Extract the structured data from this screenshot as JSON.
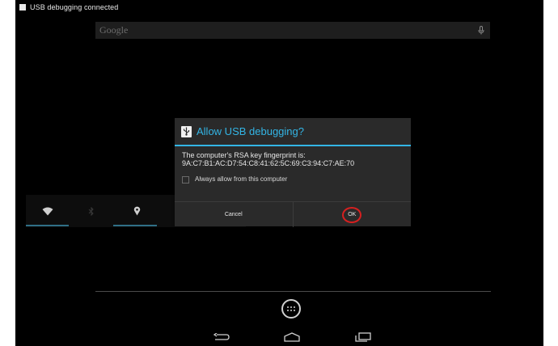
{
  "status_bar": {
    "notification_text": "USB debugging connected",
    "notification_icon": "usb-debug-notification-icon"
  },
  "search": {
    "brand": "Google",
    "mic_icon": "microphone-icon"
  },
  "quick_settings": {
    "icons": [
      "wifi-icon",
      "bluetooth-icon",
      "location-icon"
    ]
  },
  "dialog": {
    "title": "Allow USB debugging?",
    "title_icon": "usb-icon",
    "message_line1": "The computer's RSA key fingerprint is:",
    "message_line2": "9A:C7:B1:AC:D7:54:C8:41:62:5C:69:C3:94:C7:AE:70",
    "checkbox_label": "Always allow from this computer",
    "checkbox_checked": false,
    "cancel_label": "Cancel",
    "ok_label": "OK",
    "accent_color": "#33b5e5",
    "highlight_color": "#d62020"
  },
  "dock": {
    "apps_icon": "all-apps-icon"
  },
  "navigation": {
    "buttons": [
      "back-icon",
      "home-icon",
      "recent-apps-icon"
    ]
  }
}
